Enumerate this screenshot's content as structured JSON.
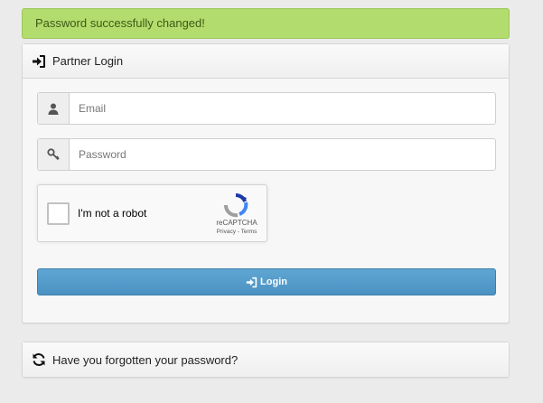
{
  "alert": {
    "message": "Password successfully changed!"
  },
  "login_panel": {
    "title": "Partner Login",
    "title_icon": "sign-in-icon",
    "email": {
      "placeholder": "Email",
      "value": "",
      "icon": "user-icon"
    },
    "password": {
      "placeholder": "Password",
      "value": "",
      "icon": "key-icon"
    },
    "captcha": {
      "label": "I'm not a robot",
      "brand": "reCAPTCHA",
      "links": "Privacy - Terms",
      "icon": "recaptcha-icon"
    },
    "login_button": {
      "label": "Login",
      "icon": "sign-in-icon"
    }
  },
  "forgot_panel": {
    "title": "Have you forgotten your password?",
    "icon": "refresh-icon"
  },
  "colors": {
    "alert_bg": "#b2dc6d",
    "button_bg": "#4a92c2",
    "page_bg": "#ebebeb"
  }
}
